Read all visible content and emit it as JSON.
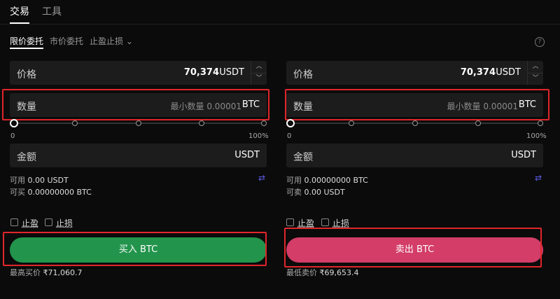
{
  "tabs": [
    {
      "label": "交易",
      "active": true
    },
    {
      "label": "工具",
      "active": false
    }
  ],
  "order_types": [
    {
      "label": "限价委托",
      "active": true
    },
    {
      "label": "市价委托",
      "active": false
    },
    {
      "label": "止盈止损",
      "active": false
    }
  ],
  "help_icon": "?",
  "buy": {
    "price": {
      "label": "价格",
      "value": "70,374",
      "unit": "USDT"
    },
    "qty": {
      "label": "数量",
      "placeholder": "最小数量 0.00001",
      "unit": "BTC"
    },
    "slider": {
      "min": "0",
      "max": "100%",
      "value_fraction": 0
    },
    "amount": {
      "label": "金额",
      "unit": "USDT"
    },
    "available": {
      "label": "可用",
      "value": "0.00 USDT"
    },
    "can": {
      "label": "可买",
      "value": "0.00000000 BTC"
    },
    "tp": "止盈",
    "sl": "止损",
    "button": "买入 BTC",
    "best": {
      "label": "最高买价",
      "value": "₹71,060.7"
    }
  },
  "sell": {
    "price": {
      "label": "价格",
      "value": "70,374",
      "unit": "USDT"
    },
    "qty": {
      "label": "数量",
      "placeholder": "最小数量 0.00001",
      "unit": "BTC"
    },
    "slider": {
      "min": "0",
      "max": "100%",
      "value_fraction": 0
    },
    "amount": {
      "label": "金额",
      "unit": "USDT"
    },
    "available": {
      "label": "可用",
      "value": "0.00000000 BTC"
    },
    "can": {
      "label": "可卖",
      "value": "0.00 USDT"
    },
    "tp": "止盈",
    "sl": "止损",
    "button": "卖出 BTC",
    "best": {
      "label": "最低卖价",
      "value": "₹69,653.4"
    }
  },
  "colors": {
    "buy": "#22944c",
    "sell": "#d33d68",
    "highlight": "#e0262b"
  }
}
